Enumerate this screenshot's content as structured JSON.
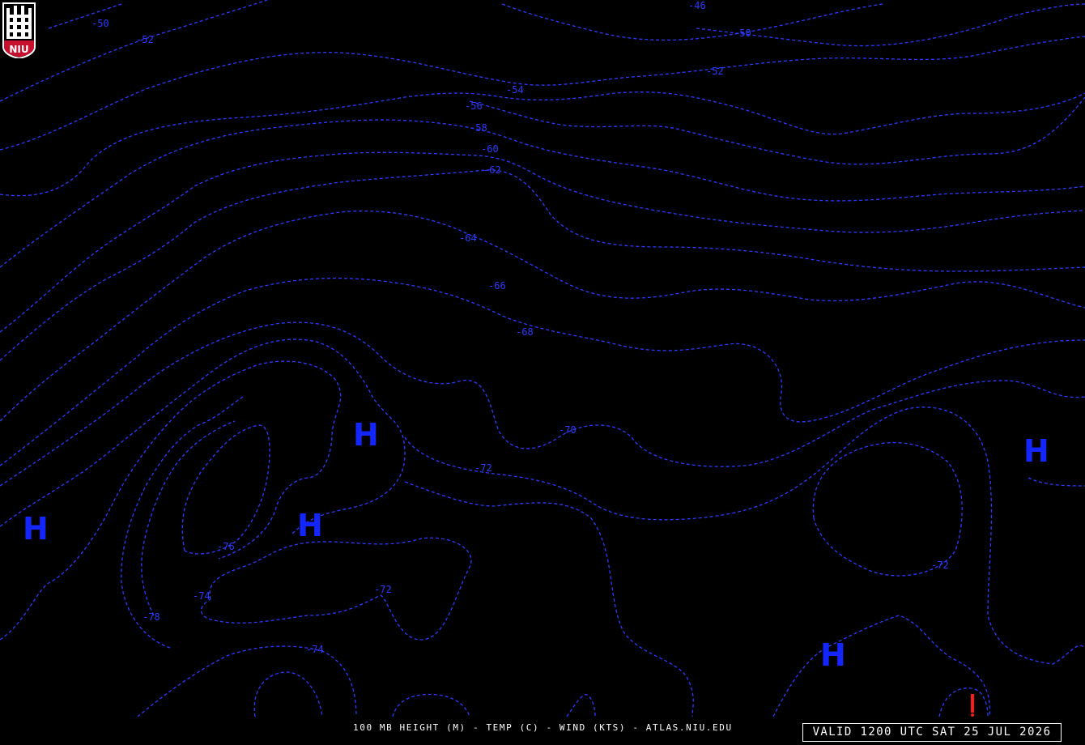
{
  "logo": {
    "text": "NIU",
    "shield_color": "#ffffff",
    "band_color": "#c8102e"
  },
  "map": {
    "background": "#000000",
    "contour_color": "#2b3cff",
    "contour_style": "dashed",
    "contour_labels": [
      "-50",
      "-52",
      "-46",
      "-50",
      "-52",
      "-54",
      "-56",
      "-58",
      "-60",
      "-62",
      "-64",
      "-66",
      "-68",
      "-70",
      "-72",
      "-72",
      "-72",
      "-76",
      "-74",
      "-78",
      "-74"
    ],
    "high_marker": "H",
    "high_count": 5,
    "wind_marker_color": "#ff1a1a"
  },
  "footer": {
    "caption": "100 MB HEIGHT (M) - TEMP (C) - WIND (KTS) - ATLAS.NIU.EDU",
    "valid_time": "VALID 1200 UTC SAT 25 JUL 2026"
  }
}
